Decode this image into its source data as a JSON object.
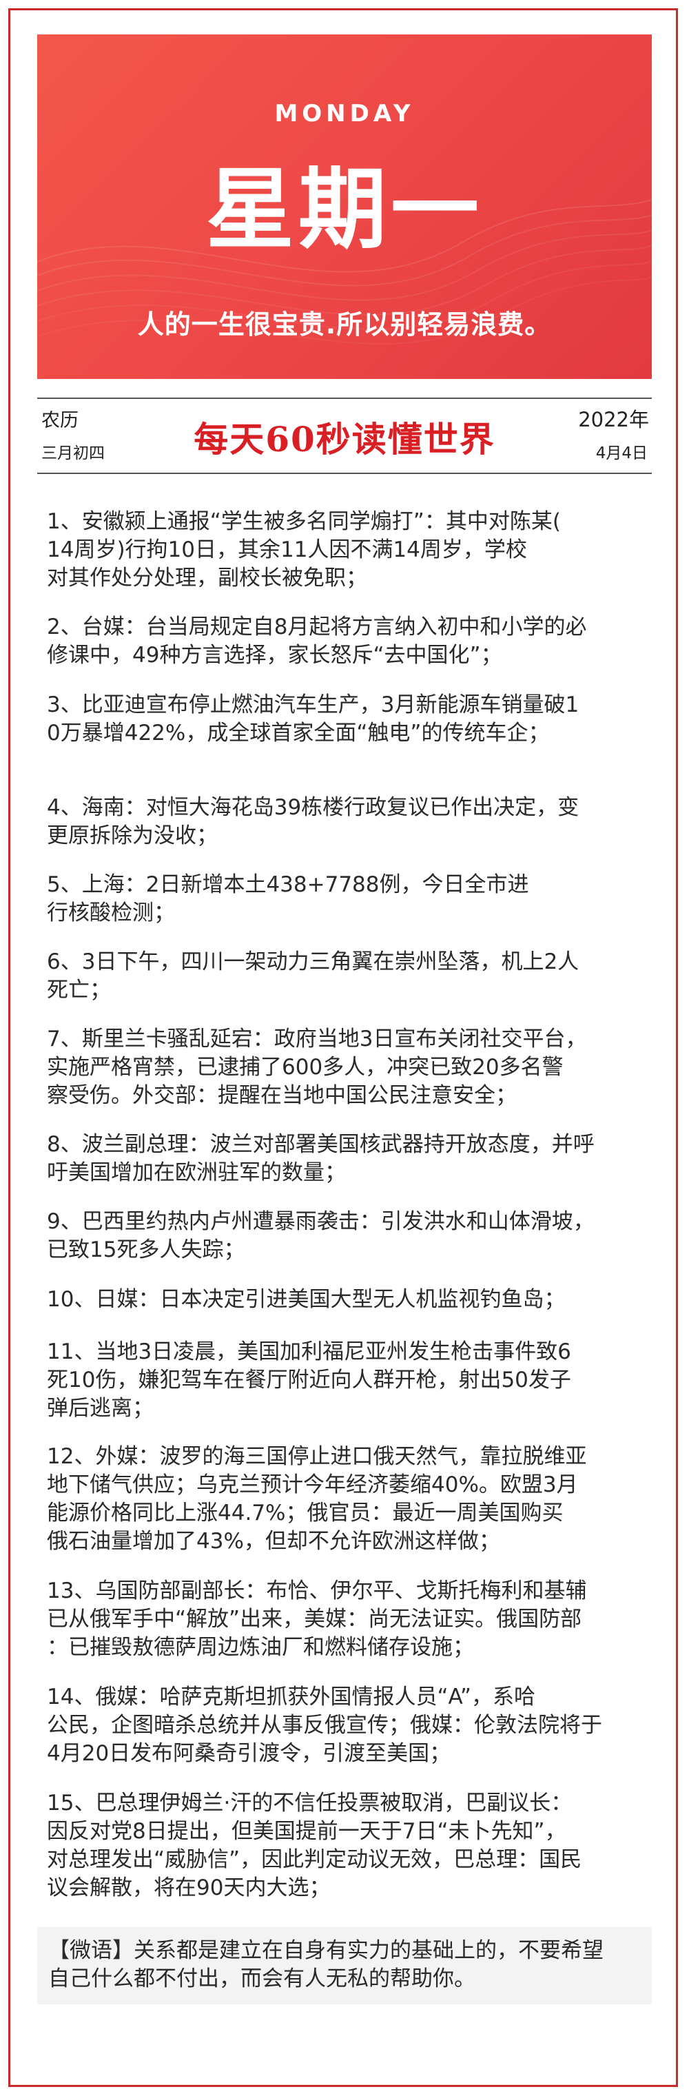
{
  "banner": {
    "weekday_en": "MONDAY",
    "weekday_cn": "星期一",
    "motto": "人的一生很宝贵.所以别轻易浪费。"
  },
  "dateline": {
    "lunar_label": "农历",
    "lunar_date": "三月初四",
    "masthead": "每天60秒读懂世界",
    "year": "2022年",
    "month_day": "4月4日"
  },
  "news": [
    {
      "text": "1、安徽颍上通报“学生被多名同学煽打”：其中对陈某(\n14周岁)行拘10日，其余11人因不满14周岁，学校\n对其作处分处理，副校长被免职；"
    },
    {
      "text": "2、台媒：台当局规定自8月起将方言纳入初中和小学的必\n修课中，49种方言选择，家长怒斥“去中国化”；"
    },
    {
      "text": "3、比亚迪宣布停止燃油汽车生产，3月新能源车销量破1\n0万暴增422%，成全球首家全面“触电”的传统车企；"
    },
    {
      "text": "4、海南：对恒大海花岛39栋楼行政复议已作出决定，变\n更原拆除为没收；"
    },
    {
      "text": "5、上海：2日新增本土438+7788例，今日全市进\n行核酸检测；"
    },
    {
      "text": "6、3日下午，四川一架动力三角翼在崇州坠落，机上2人\n死亡；"
    },
    {
      "text": "7、斯里兰卡骚乱延宕：政府当地3日宣布关闭社交平台，\n实施严格宵禁，已逮捕了600多人，冲突已致20多名警\n察受伤。外交部：提醒在当地中国公民注意安全；"
    },
    {
      "text": "8、波兰副总理：波兰对部署美国核武器持开放态度，并呼\n吁美国增加在欧洲驻军的数量；"
    },
    {
      "text": "9、巴西里约热内卢州遭暴雨袭击：引发洪水和山体滑坡，\n已致15死多人失踪；"
    },
    {
      "text": "10、日媒：日本决定引进美国大型无人机监视钓鱼岛；"
    },
    {
      "text": "11、当地3日凌晨，美国加利福尼亚州发生枪击事件致6\n死10伤，嫌犯驾车在餐厅附近向人群开枪，射出50发子\n弹后逃离；"
    },
    {
      "text": "12、外媒：波罗的海三国停止进口俄天然气，靠拉脱维亚\n地下储气供应；乌克兰预计今年经济萎缩40%。欧盟3月\n能源价格同比上涨44.7%；俄官员：最近一周美国购买\n俄石油量增加了43%，但却不允许欧洲这样做；"
    },
    {
      "text": "13、乌国防部副部长：布恰、伊尔平、戈斯托梅利和基辅\n已从俄军手中“解放”出来，美媒：尚无法证实。俄国防部\n：已摧毁敖德萨周边炼油厂和燃料储存设施；"
    },
    {
      "text": "14、俄媒：哈萨克斯坦抓获外国情报人员“A”，系哈\n公民，企图暗杀总统并从事反俄宣传；俄媒：伦敦法院将于\n4月20日发布阿桑奇引渡令，引渡至美国；"
    },
    {
      "text": "15、巴总理伊姆兰·汗的不信任投票被取消，巴副议长：\n因反对党8日提出，但美国提前一天于7日“未卜先知”，\n对总理发出“威胁信”，因此判定动议无效，巴总理：国民\n议会解散，将在90天内大选；"
    }
  ],
  "motto_box": {
    "text": "【微语】关系都是建立在自身有实力的基础上的，不要希望\n自己什么都不付出，而会有人无私的帮助你。"
  },
  "colors": {
    "accent": "#d91f24",
    "banner": "#ee4a48",
    "border": "#c92a2a"
  }
}
